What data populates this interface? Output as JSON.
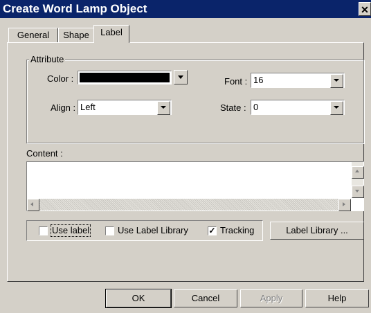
{
  "window": {
    "title": "Create Word Lamp  Object",
    "close_glyph": "✕"
  },
  "tabs": [
    {
      "label": "General",
      "active": false
    },
    {
      "label": "Shape",
      "active": false
    },
    {
      "label": "Label",
      "active": true
    }
  ],
  "attribute": {
    "group_label": "Attribute",
    "color_label": "Color :",
    "color_value": "#000000",
    "font_label": "Font :",
    "font_value": "16",
    "align_label": "Align :",
    "align_value": "Left",
    "state_label": "State :",
    "state_value": "0"
  },
  "content": {
    "label": "Content :",
    "value": ""
  },
  "options": {
    "use_label": {
      "label": "Use label",
      "checked": false
    },
    "use_label_library": {
      "label": "Use Label Library",
      "checked": false
    },
    "tracking": {
      "label": "Tracking",
      "checked": true,
      "check_glyph": "✓"
    },
    "label_library_button": "Label Library ..."
  },
  "footer": {
    "ok": "OK",
    "cancel": "Cancel",
    "apply": "Apply",
    "help": "Help"
  }
}
